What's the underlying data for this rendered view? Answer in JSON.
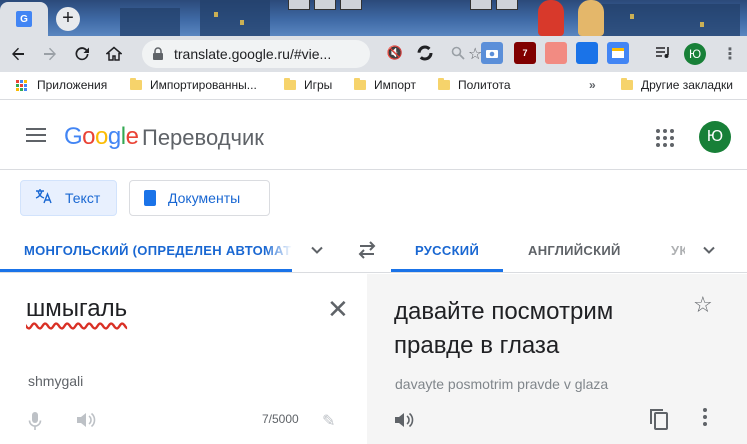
{
  "browser": {
    "tab_favicon_letter": "G",
    "new_tab_label": "+",
    "address": "translate.google.ru/#vie...",
    "profile_letter": "Ю",
    "extension_badge": "7",
    "icons": [
      "back-icon",
      "forward-icon",
      "reload-icon",
      "home-icon",
      "lock-icon",
      "star-icon",
      "mute-icon",
      "sync-icon",
      "search-icon",
      "camera-icon",
      "ublock-icon",
      "extension-icon",
      "pdf-icon",
      "translate-extension-icon",
      "window-icon",
      "media-icon",
      "menu-icon"
    ]
  },
  "bookmarks": {
    "items": [
      {
        "label": "Приложения",
        "icon": "apps-icon"
      },
      {
        "label": "Импортированны...",
        "icon": "folder-icon"
      },
      {
        "label": "Игры",
        "icon": "folder-icon"
      },
      {
        "label": "Импорт",
        "icon": "folder-icon"
      },
      {
        "label": "Политота",
        "icon": "folder-icon"
      }
    ],
    "overflow": "»",
    "other": "Другие закладки"
  },
  "header": {
    "logo": "Google",
    "product": "Переводчик",
    "account_letter": "Ю"
  },
  "modes": {
    "text": "Текст",
    "documents": "Документы"
  },
  "languages": {
    "source": "МОНГОЛЬСКИЙ (ОПРЕДЕЛЕН АВТОМАТИЧЕСКИ)",
    "target_active": "РУССКИЙ",
    "target_2": "АНГЛИЙСКИЙ",
    "target_3": "УКРАИНСКИЙ"
  },
  "source": {
    "text": "шмыгаль",
    "transliteration": "shmygali",
    "counter": "7/5000"
  },
  "target": {
    "text": "давайте посмотрим правде в глаза",
    "transliteration": "davayte posmotrim pravde v glaza"
  },
  "colors": {
    "accent": "#1a73e8",
    "profile_green": "#188038",
    "spell_error": "#d93025"
  }
}
